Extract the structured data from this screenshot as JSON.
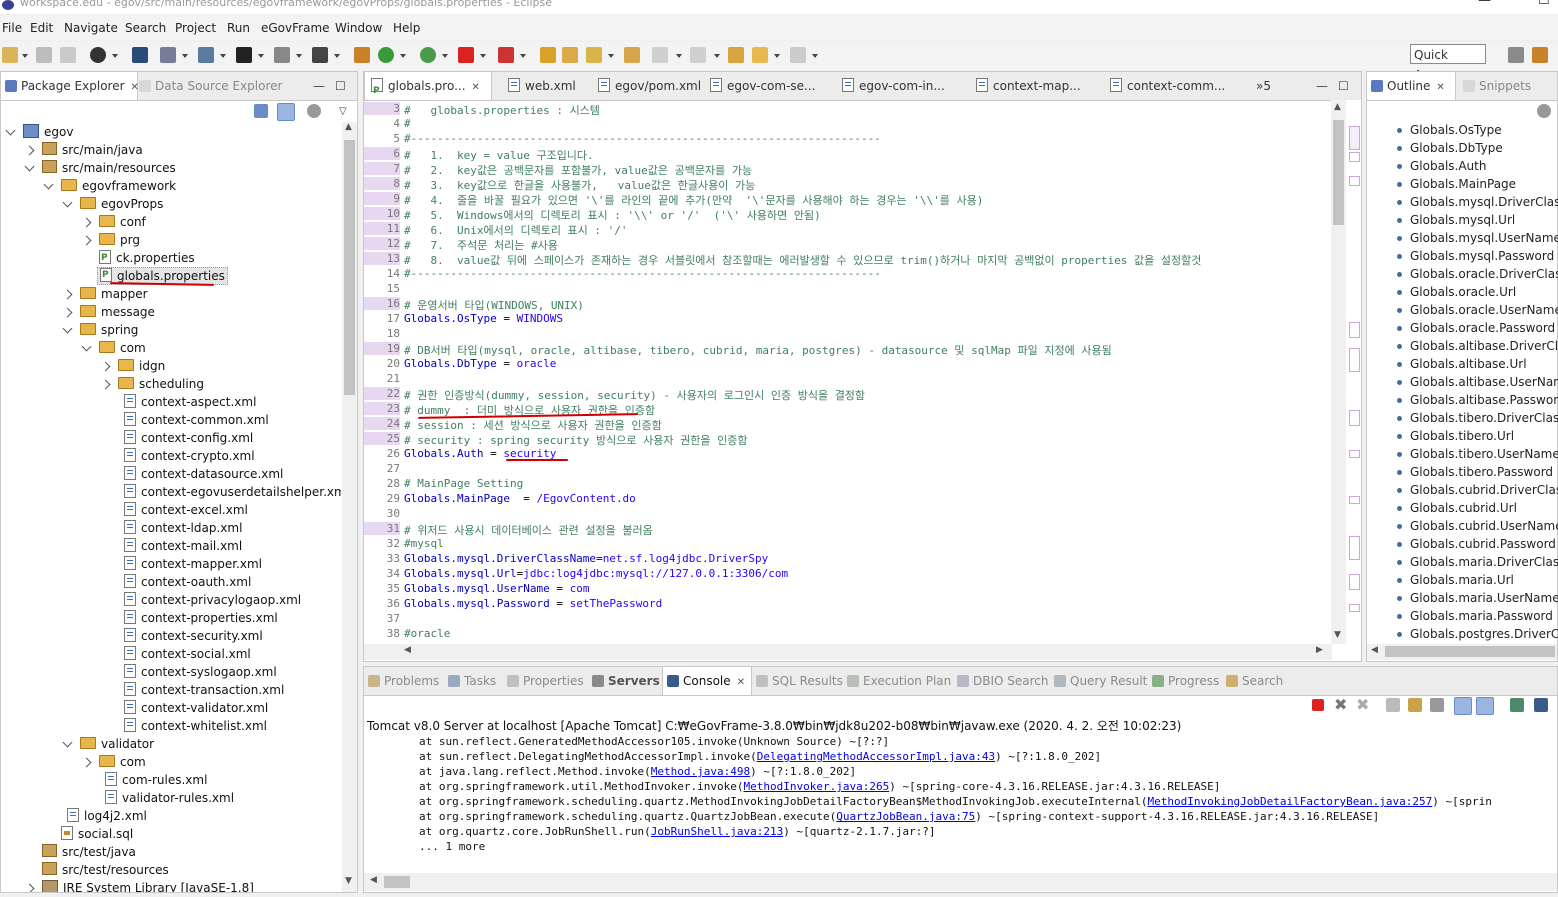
{
  "window": {
    "title": "workspace.edu - egov/src/main/resources/egovframework/egovProps/globals.properties - Eclipse",
    "controls": [
      "—",
      "☐"
    ]
  },
  "menu": [
    "File",
    "Edit",
    "Navigate",
    "Search",
    "Project",
    "Run",
    "eGovFrame",
    "Window",
    "Help"
  ],
  "quick_access": "Quick Access",
  "left_tabs": {
    "package_explorer": "Package Explorer",
    "data_source": "Data Source Explorer"
  },
  "tree": [
    {
      "label": "egov",
      "indent": 0,
      "icon": "project",
      "arrow": "down"
    },
    {
      "label": "src/main/java",
      "indent": 1,
      "icon": "pkgfolder",
      "arrow": "right"
    },
    {
      "label": "src/main/resources",
      "indent": 1,
      "icon": "pkgfolder",
      "arrow": "down"
    },
    {
      "label": "egovframework",
      "indent": 2,
      "icon": "folder",
      "arrow": "down"
    },
    {
      "label": "egovProps",
      "indent": 3,
      "icon": "folder",
      "arrow": "down"
    },
    {
      "label": "conf",
      "indent": 4,
      "icon": "folder",
      "arrow": "right"
    },
    {
      "label": "prg",
      "indent": 4,
      "icon": "folder",
      "arrow": "right"
    },
    {
      "label": "ck.properties",
      "indent": 4,
      "icon": "file-p",
      "arrow": ""
    },
    {
      "label": "globals.properties",
      "indent": 4,
      "icon": "file-p",
      "arrow": "",
      "selected": true
    },
    {
      "label": "mapper",
      "indent": 3,
      "icon": "folder",
      "arrow": "right"
    },
    {
      "label": "message",
      "indent": 3,
      "icon": "folder",
      "arrow": "right"
    },
    {
      "label": "spring",
      "indent": 3,
      "icon": "folder",
      "arrow": "down"
    },
    {
      "label": "com",
      "indent": 4,
      "icon": "folder",
      "arrow": "down"
    },
    {
      "label": "idgn",
      "indent": 5,
      "icon": "folder",
      "arrow": "right"
    },
    {
      "label": "scheduling",
      "indent": 5,
      "icon": "folder",
      "arrow": "right"
    },
    {
      "label": "context-aspect.xml",
      "indent": 5,
      "icon": "file-x",
      "arrow": ""
    },
    {
      "label": "context-common.xml",
      "indent": 5,
      "icon": "file-x",
      "arrow": ""
    },
    {
      "label": "context-config.xml",
      "indent": 5,
      "icon": "file-x",
      "arrow": ""
    },
    {
      "label": "context-crypto.xml",
      "indent": 5,
      "icon": "file-x",
      "arrow": ""
    },
    {
      "label": "context-datasource.xml",
      "indent": 5,
      "icon": "file-x",
      "arrow": ""
    },
    {
      "label": "context-egovuserdetailshelper.xml",
      "indent": 5,
      "icon": "file-x",
      "arrow": ""
    },
    {
      "label": "context-excel.xml",
      "indent": 5,
      "icon": "file-x",
      "arrow": ""
    },
    {
      "label": "context-ldap.xml",
      "indent": 5,
      "icon": "file-x",
      "arrow": ""
    },
    {
      "label": "context-mail.xml",
      "indent": 5,
      "icon": "file-x",
      "arrow": ""
    },
    {
      "label": "context-mapper.xml",
      "indent": 5,
      "icon": "file-x",
      "arrow": ""
    },
    {
      "label": "context-oauth.xml",
      "indent": 5,
      "icon": "file-x",
      "arrow": ""
    },
    {
      "label": "context-privacylogaop.xml",
      "indent": 5,
      "icon": "file-x",
      "arrow": ""
    },
    {
      "label": "context-properties.xml",
      "indent": 5,
      "icon": "file-x",
      "arrow": ""
    },
    {
      "label": "context-security.xml",
      "indent": 5,
      "icon": "file-x",
      "arrow": ""
    },
    {
      "label": "context-social.xml",
      "indent": 5,
      "icon": "file-x",
      "arrow": ""
    },
    {
      "label": "context-syslogaop.xml",
      "indent": 5,
      "icon": "file-x",
      "arrow": ""
    },
    {
      "label": "context-transaction.xml",
      "indent": 5,
      "icon": "file-x",
      "arrow": ""
    },
    {
      "label": "context-validator.xml",
      "indent": 5,
      "icon": "file-x",
      "arrow": ""
    },
    {
      "label": "context-whitelist.xml",
      "indent": 5,
      "icon": "file-x",
      "arrow": ""
    },
    {
      "label": "validator",
      "indent": 3,
      "icon": "folder",
      "arrow": "down"
    },
    {
      "label": "com",
      "indent": 4,
      "icon": "folder",
      "arrow": "right"
    },
    {
      "label": "com-rules.xml",
      "indent": 4,
      "icon": "file-x",
      "arrow": ""
    },
    {
      "label": "validator-rules.xml",
      "indent": 4,
      "icon": "file-x",
      "arrow": ""
    },
    {
      "label": "log4j2.xml",
      "indent": 2,
      "icon": "file-x",
      "arrow": ""
    },
    {
      "label": "social.sql",
      "indent": 2,
      "icon": "file-l",
      "arrow": ""
    },
    {
      "label": "src/test/java",
      "indent": 1,
      "icon": "pkgfolder",
      "arrow": ""
    },
    {
      "label": "src/test/resources",
      "indent": 1,
      "icon": "pkgfolder",
      "arrow": ""
    },
    {
      "label": "JRE System Library [JavaSE-1.8]",
      "indent": 1,
      "icon": "jar",
      "arrow": "right"
    }
  ],
  "editor_tabs": [
    {
      "label": "globals.pro...",
      "active": true
    },
    {
      "label": "web.xml"
    },
    {
      "label": "egov/pom.xml"
    },
    {
      "label": "egov-com-se..."
    },
    {
      "label": "egov-com-in..."
    },
    {
      "label": "context-map..."
    },
    {
      "label": "context-comm..."
    }
  ],
  "editor_overflow": "»5",
  "code_lines": [
    {
      "n": "3",
      "mark": true,
      "parts": [
        [
          "com",
          "#   globals.properties : 시스템"
        ]
      ]
    },
    {
      "n": "4",
      "parts": [
        [
          "com",
          "#"
        ]
      ]
    },
    {
      "n": "5",
      "parts": [
        [
          "com",
          "#-----------------------------------------------------------------------"
        ]
      ]
    },
    {
      "n": "6",
      "mark": true,
      "parts": [
        [
          "com",
          "#   1.  key = value 구조입니다."
        ]
      ]
    },
    {
      "n": "7",
      "mark": true,
      "parts": [
        [
          "com",
          "#   2.  key값은 공백문자를 포함불가, value값은 공백문자를 가능"
        ]
      ]
    },
    {
      "n": "8",
      "mark": true,
      "parts": [
        [
          "com",
          "#   3.  key값으로 한글을 사용불가,   value값은 한글사용이 가능"
        ]
      ]
    },
    {
      "n": "9",
      "mark": true,
      "parts": [
        [
          "com",
          "#   4.  줄을 바꿀 필요가 있으면 '\\'를 라인의 끝에 추가(만약  '\\'문자를 사용해야 하는 경우는 '\\\\'를 사용)"
        ]
      ]
    },
    {
      "n": "10",
      "mark": true,
      "parts": [
        [
          "com",
          "#   5.  Windows에서의 디렉토리 표시 : '\\\\' or '/'  ('\\' 사용하면 안됨)"
        ]
      ]
    },
    {
      "n": "11",
      "mark": true,
      "parts": [
        [
          "com",
          "#   6.  Unix에서의 디렉토리 표시 : '/'"
        ]
      ]
    },
    {
      "n": "12",
      "mark": true,
      "parts": [
        [
          "com",
          "#   7.  주석문 처리는 #사용"
        ]
      ]
    },
    {
      "n": "13",
      "mark": true,
      "parts": [
        [
          "com",
          "#   8.  value값 뒤에 스페이스가 존재하는 경우 서블릿에서 참조할때는 에러발생할 수 있으므로 trim()하거나 마지막 공백없이 properties 값을 설정할것"
        ]
      ]
    },
    {
      "n": "14",
      "parts": [
        [
          "com",
          "#-----------------------------------------------------------------------"
        ]
      ]
    },
    {
      "n": "15",
      "parts": []
    },
    {
      "n": "16",
      "mark": true,
      "parts": [
        [
          "com",
          "# 운영서버 타입(WINDOWS, UNIX)"
        ]
      ]
    },
    {
      "n": "17",
      "parts": [
        [
          "key",
          "Globals.OsType"
        ],
        [
          "plain",
          " = "
        ],
        [
          "val",
          "WINDOWS"
        ]
      ]
    },
    {
      "n": "18",
      "parts": []
    },
    {
      "n": "19",
      "mark": true,
      "parts": [
        [
          "com",
          "# DB서버 타입(mysql, oracle, altibase, tibero, cubrid, maria, postgres) - datasource 및 sqlMap 파일 지정에 사용됨"
        ]
      ]
    },
    {
      "n": "20",
      "parts": [
        [
          "key",
          "Globals.DbType"
        ],
        [
          "plain",
          " = "
        ],
        [
          "val",
          "oracle"
        ]
      ]
    },
    {
      "n": "21",
      "parts": []
    },
    {
      "n": "22",
      "mark": true,
      "parts": [
        [
          "com",
          "# 권한 인증방식(dummy, session, security) - 사용자의 로그인시 인증 방식을 결정함"
        ]
      ]
    },
    {
      "n": "23",
      "mark": true,
      "parts": [
        [
          "com",
          "# dummy  : 더미 방식으로 사용자 권한을 인증함"
        ]
      ]
    },
    {
      "n": "24",
      "mark": true,
      "parts": [
        [
          "com",
          "# session : 세션 방식으로 사용자 권한을 인증함"
        ]
      ]
    },
    {
      "n": "25",
      "mark": true,
      "parts": [
        [
          "com",
          "# security : spring security 방식으로 사용자 권한을 인증함"
        ]
      ]
    },
    {
      "n": "26",
      "parts": [
        [
          "key",
          "Globals.Auth"
        ],
        [
          "plain",
          " = "
        ],
        [
          "val",
          "security"
        ]
      ]
    },
    {
      "n": "27",
      "parts": []
    },
    {
      "n": "28",
      "parts": [
        [
          "com",
          "# MainPage Setting"
        ]
      ]
    },
    {
      "n": "29",
      "parts": [
        [
          "key",
          "Globals.MainPage"
        ],
        [
          "plain",
          "  = "
        ],
        [
          "val",
          "/EgovContent.do"
        ]
      ]
    },
    {
      "n": "30",
      "parts": []
    },
    {
      "n": "31",
      "mark": true,
      "parts": [
        [
          "com",
          "# 위저드 사용시 데이터베이스 관련 설정을 불러옴"
        ]
      ]
    },
    {
      "n": "32",
      "parts": [
        [
          "com",
          "#mysql"
        ]
      ]
    },
    {
      "n": "33",
      "parts": [
        [
          "key",
          "Globals.mysql.DriverClassName"
        ],
        [
          "plain",
          "="
        ],
        [
          "val",
          "net.sf.log4jdbc.DriverSpy"
        ]
      ]
    },
    {
      "n": "34",
      "parts": [
        [
          "key",
          "Globals.mysql.Url"
        ],
        [
          "plain",
          "="
        ],
        [
          "val",
          "jdbc:log4jdbc:mysql://127.0.0.1:3306/com"
        ]
      ]
    },
    {
      "n": "35",
      "parts": [
        [
          "key",
          "Globals.mysql.UserName"
        ],
        [
          "plain",
          " = "
        ],
        [
          "val",
          "com"
        ]
      ]
    },
    {
      "n": "36",
      "parts": [
        [
          "key",
          "Globals.mysql.Password"
        ],
        [
          "plain",
          " = "
        ],
        [
          "val",
          "setThePassword"
        ]
      ]
    },
    {
      "n": "37",
      "parts": []
    },
    {
      "n": "38",
      "parts": [
        [
          "com",
          "#oracle"
        ]
      ]
    }
  ],
  "outline_tabs": {
    "outline": "Outline",
    "snippets": "Snippets"
  },
  "outline": [
    "Globals.OsType",
    "Globals.DbType",
    "Globals.Auth",
    "Globals.MainPage",
    "Globals.mysql.DriverClassName",
    "Globals.mysql.Url",
    "Globals.mysql.UserName",
    "Globals.mysql.Password",
    "Globals.oracle.DriverClassName",
    "Globals.oracle.Url",
    "Globals.oracle.UserName",
    "Globals.oracle.Password",
    "Globals.altibase.DriverClassName",
    "Globals.altibase.Url",
    "Globals.altibase.UserName",
    "Globals.altibase.Password",
    "Globals.tibero.DriverClassName",
    "Globals.tibero.Url",
    "Globals.tibero.UserName",
    "Globals.tibero.Password",
    "Globals.cubrid.DriverClassName",
    "Globals.cubrid.Url",
    "Globals.cubrid.UserName",
    "Globals.cubrid.Password",
    "Globals.maria.DriverClassName",
    "Globals.maria.Url",
    "Globals.maria.UserName",
    "Globals.maria.Password",
    "Globals.postgres.DriverClassName"
  ],
  "bottom_tabs": [
    {
      "label": "Problems"
    },
    {
      "label": "Tasks"
    },
    {
      "label": "Properties"
    },
    {
      "label": "Servers",
      "bold": true
    },
    {
      "label": "Console",
      "active": true
    },
    {
      "label": "SQL Results"
    },
    {
      "label": "Execution Plan"
    },
    {
      "label": "DBIO Search"
    },
    {
      "label": "Query Result"
    },
    {
      "label": "Progress"
    },
    {
      "label": "Search"
    }
  ],
  "console_title": "Tomcat v8.0 Server at localhost [Apache Tomcat] C:₩eGovFrame-3.8.0₩bin₩jdk8u202-b08₩bin₩javaw.exe (2020. 4. 2. 오전 10:02:23)",
  "console_lines": [
    [
      [
        "t",
        "        at sun.reflect.GeneratedMethodAccessor105.invoke(Unknown Source) ~[?:?]"
      ]
    ],
    [
      [
        "t",
        "        at sun.reflect.DelegatingMethodAccessorImpl.invoke("
      ],
      [
        "l",
        "DelegatingMethodAccessorImpl.java:43"
      ],
      [
        "t",
        ") ~[?:1.8.0_202]"
      ]
    ],
    [
      [
        "t",
        "        at java.lang.reflect.Method.invoke("
      ],
      [
        "l",
        "Method.java:498"
      ],
      [
        "t",
        ") ~[?:1.8.0_202]"
      ]
    ],
    [
      [
        "t",
        "        at org.springframework.util.MethodInvoker.invoke("
      ],
      [
        "l",
        "MethodInvoker.java:265"
      ],
      [
        "t",
        ") ~[spring-core-4.3.16.RELEASE.jar:4.3.16.RELEASE]"
      ]
    ],
    [
      [
        "t",
        "        at org.springframework.scheduling.quartz.MethodInvokingJobDetailFactoryBean$MethodInvokingJob.executeInternal("
      ],
      [
        "l",
        "MethodInvokingJobDetailFactoryBean.java:257"
      ],
      [
        "t",
        ") ~[sprin"
      ]
    ],
    [
      [
        "t",
        "        at org.springframework.scheduling.quartz.QuartzJobBean.execute("
      ],
      [
        "l",
        "QuartzJobBean.java:75"
      ],
      [
        "t",
        ") ~[spring-context-support-4.3.16.RELEASE.jar:4.3.16.RELEASE]"
      ]
    ],
    [
      [
        "t",
        "        at org.quartz.core.JobRunShell.run("
      ],
      [
        "l",
        "JobRunShell.java:213"
      ],
      [
        "t",
        ") ~[quartz-2.1.7.jar:?]"
      ]
    ],
    [
      [
        "t",
        "        ... 1 more"
      ]
    ]
  ]
}
